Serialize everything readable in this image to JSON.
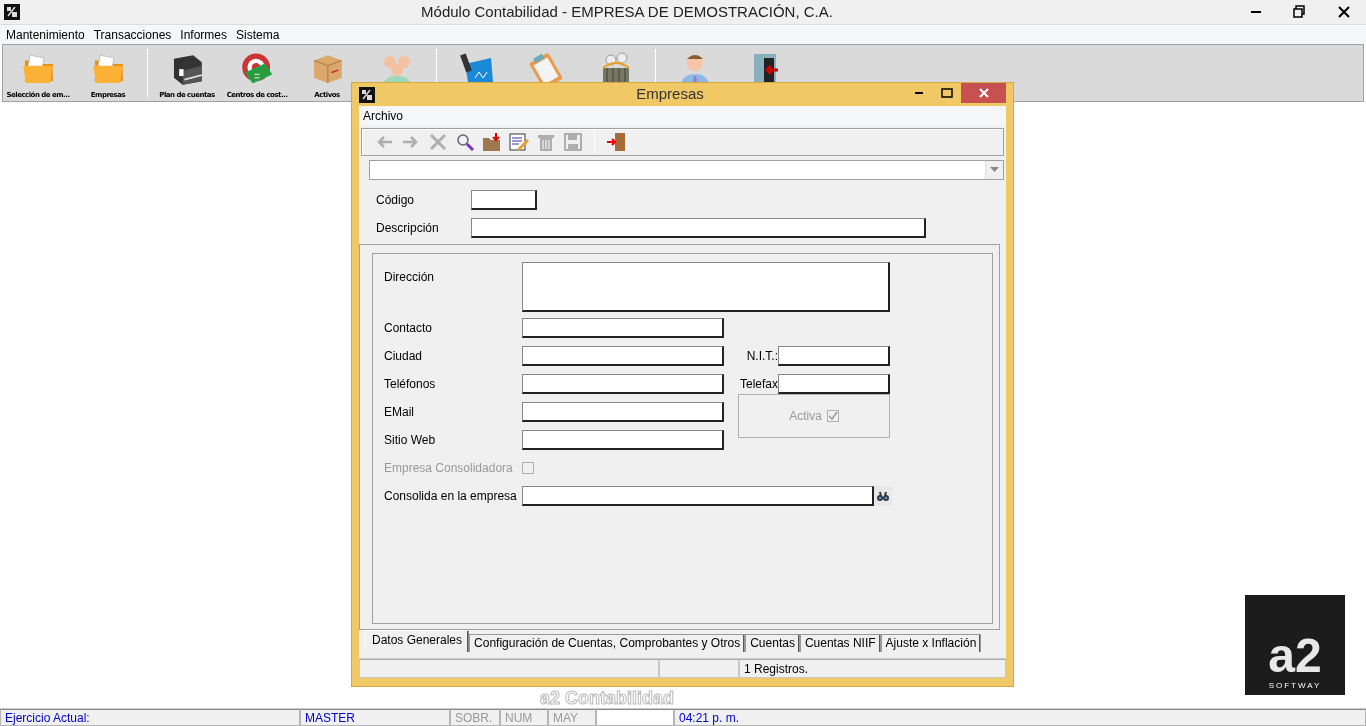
{
  "window": {
    "title": "Módulo Contabilidad - EMPRESA DE DEMOSTRACIÓN, C.A."
  },
  "menu": [
    {
      "label": "Mantenimiento"
    },
    {
      "label": "Transacciones"
    },
    {
      "label": "Informes"
    },
    {
      "label": "Sistema"
    }
  ],
  "toolbar": [
    {
      "kind": "button",
      "label": "Selección de em..."
    },
    {
      "kind": "button",
      "label": "Empresas"
    },
    {
      "kind": "separator"
    },
    {
      "kind": "button",
      "label": "Plan de cuentas"
    },
    {
      "kind": "button",
      "label": "Centros de cost..."
    },
    {
      "kind": "button",
      "label": "Activos"
    },
    {
      "kind": "button"
    },
    {
      "kind": "separator"
    },
    {
      "kind": "button"
    },
    {
      "kind": "button"
    },
    {
      "kind": "button"
    },
    {
      "kind": "separator"
    },
    {
      "kind": "button"
    },
    {
      "kind": "button"
    }
  ],
  "dialog": {
    "title": "Empresas",
    "menu": [
      {
        "label": "Archivo"
      }
    ],
    "tools": [
      {
        "kind": "button",
        "disabled": true
      },
      {
        "kind": "button",
        "disabled": true
      },
      {
        "kind": "button",
        "disabled": true
      },
      {
        "kind": "button",
        "disabled": false
      },
      {
        "kind": "button",
        "disabled": false
      },
      {
        "kind": "button",
        "disabled": false
      },
      {
        "kind": "button",
        "disabled": true
      },
      {
        "kind": "button",
        "disabled": true
      },
      {
        "kind": "separator"
      },
      {
        "kind": "button",
        "disabled": false
      }
    ],
    "header_fields": [
      {
        "label": "Código"
      },
      {
        "label": "Descripción"
      }
    ],
    "left_fields": [
      {
        "label": "Dirección",
        "kind": "textarea"
      },
      {
        "label": "Contacto",
        "kind": "text"
      },
      {
        "label": "Ciudad",
        "kind": "text"
      },
      {
        "label": "Teléfonos",
        "kind": "text"
      },
      {
        "label": "EMail",
        "kind": "text"
      },
      {
        "label": "Sitio Web",
        "kind": "text"
      }
    ],
    "right_fields": [
      {
        "label": "N.I.T.:"
      },
      {
        "label": "Telefax"
      }
    ],
    "activa": {
      "label": "Activa",
      "checked": true,
      "disabled": true
    },
    "consolidadora": {
      "label": "Empresa Consolidadora",
      "checked": false,
      "disabled": true
    },
    "consolida_en": {
      "label": "Consolida en la empresa"
    },
    "tabs": [
      {
        "label": "Datos Generales",
        "selected": true
      },
      {
        "label": "Configuración de Cuentas, Comprobantes y Otros",
        "selected": false
      },
      {
        "label": "Cuentas",
        "selected": false
      },
      {
        "label": "Cuentas NIIF",
        "selected": false
      },
      {
        "label": "Ajuste x Inflación",
        "selected": false
      }
    ],
    "status": {
      "records": "1 Registros."
    }
  },
  "background_caption": "a2 Contabilidad",
  "logo": {
    "brand": "a2",
    "tagline": "SOFTWAY"
  },
  "status_bar": [
    {
      "text": "Ejercicio Actual:",
      "disabled": false
    },
    {
      "text": "MASTER",
      "disabled": false
    },
    {
      "text": "SOBR.",
      "disabled": true
    },
    {
      "text": "NUM",
      "disabled": true
    },
    {
      "text": "MAY",
      "disabled": true
    },
    {
      "kind": "blank"
    },
    {
      "text": "04:21 p. m.",
      "disabled": false
    }
  ]
}
